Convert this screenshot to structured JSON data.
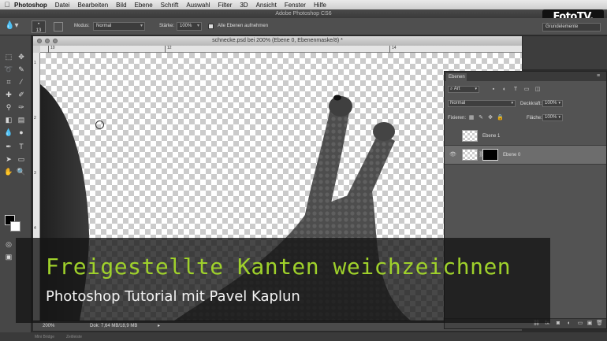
{
  "menubar": {
    "items": [
      "Photoshop",
      "Datei",
      "Bearbeiten",
      "Bild",
      "Ebene",
      "Schrift",
      "Auswahl",
      "Filter",
      "3D",
      "Ansicht",
      "Fenster",
      "Hilfe"
    ]
  },
  "app": {
    "title": "Adobe Photoshop CS6"
  },
  "options": {
    "brush_size": "13",
    "mode_label": "Modus:",
    "mode_value": "Normal",
    "strength_label": "Stärke:",
    "strength_value": "100%",
    "sample_all_label": "Alle Ebenen aufnehmen",
    "workspace_value": "Grundelemente"
  },
  "document": {
    "title": "schnecke.psd bei 200% (Ebene 0, Ebenenmaske/8) *",
    "ruler_top": [
      "10",
      "12",
      "14"
    ],
    "ruler_left": [
      "1",
      "2",
      "3",
      "4"
    ],
    "zoom": "200%",
    "doc_info": "Dok: 7,64 MB/18,9 MB"
  },
  "layers_panel": {
    "tab_label": "Ebenen",
    "filter_value": "Art",
    "blend_mode": "Normal",
    "opacity_label": "Deckkraft:",
    "opacity_value": "100%",
    "lock_label": "Fixieren:",
    "fill_label": "Fläche:",
    "fill_value": "100%",
    "layers": [
      {
        "name": "Ebene 1",
        "selected": false
      },
      {
        "name": "Ebene 0",
        "selected": true
      }
    ]
  },
  "bottom_tabs": [
    "Mini Bridge",
    "Zeitleiste"
  ],
  "overlay": {
    "headline": "Freigestellte Kanten weichzeichnen",
    "subline": "Photoshop Tutorial mit Pavel Kaplun"
  },
  "logo": {
    "text": "FotoTV."
  },
  "colors": {
    "headline": "#9fd12b",
    "panel_bg": "#535353",
    "toolbar_bg": "#474747"
  }
}
